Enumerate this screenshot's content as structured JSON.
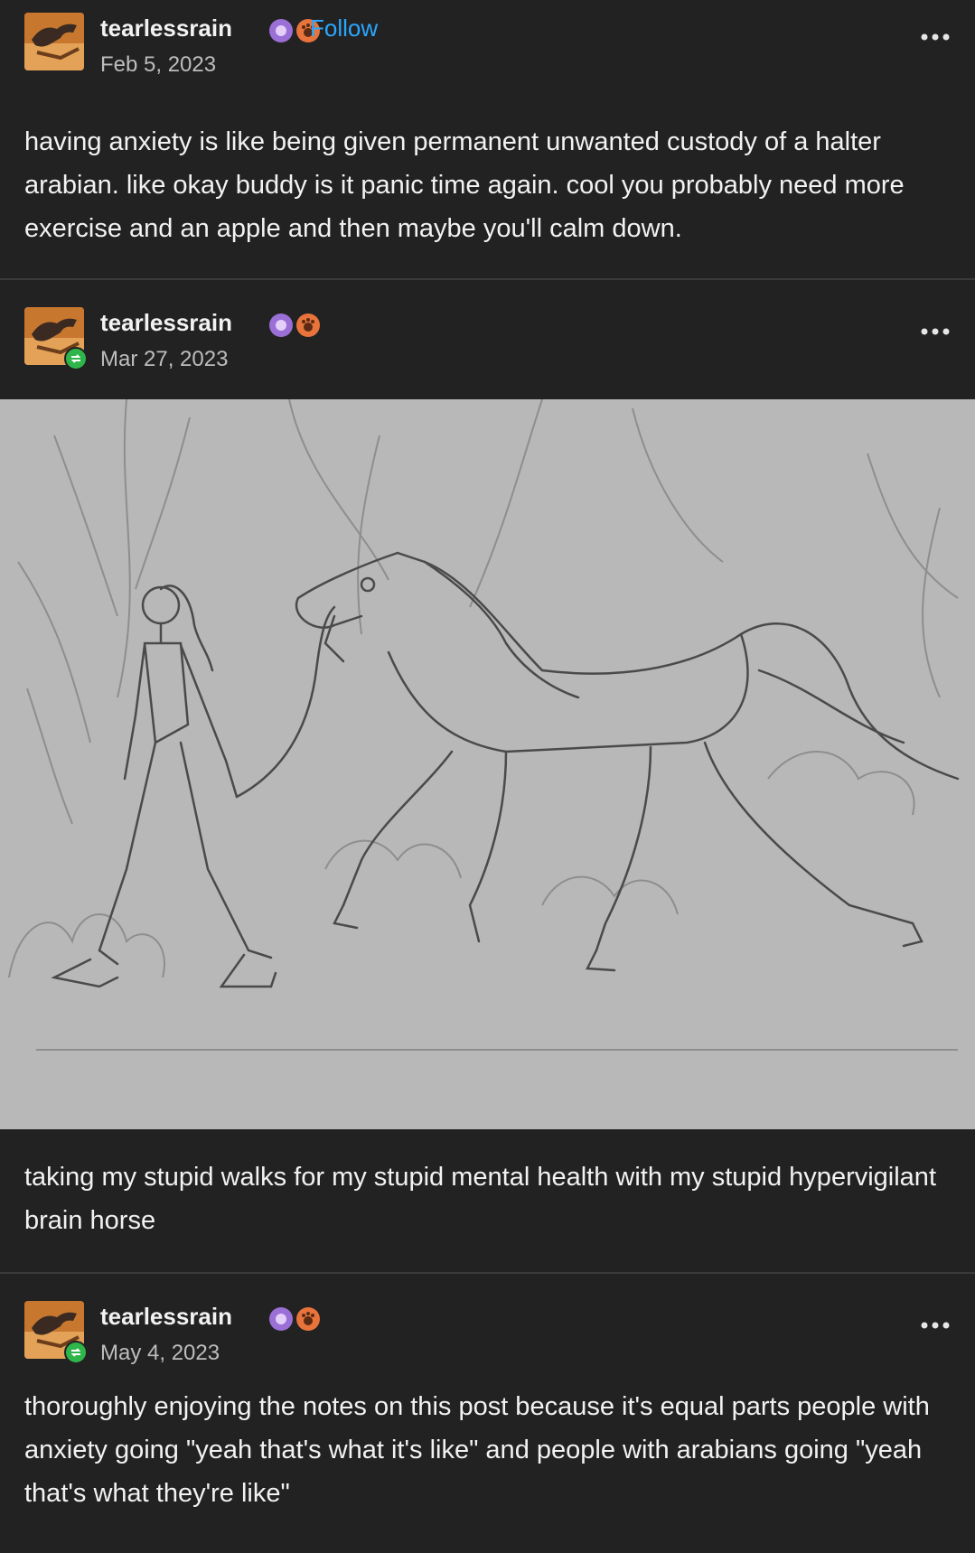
{
  "posts": [
    {
      "username": "tearlessrain",
      "follow_label": "Follow",
      "date": "Feb 5, 2023",
      "body": "having anxiety is like being given permanent unwanted custody of a halter arabian. like okay buddy is it panic time again. cool you probably need more exercise and an apple and then maybe you'll calm down."
    },
    {
      "username": "tearlessrain",
      "date": "Mar 27, 2023",
      "reblog": true,
      "body": "taking my stupid walks for my stupid mental health with my stupid hypervigilant brain horse"
    },
    {
      "username": "tearlessrain",
      "date": "May 4, 2023",
      "reblog": true,
      "body": "thoroughly enjoying the notes on this post because it's equal parts people with anxiety going \"yeah that's what it's like\" and people with arabians going \"yeah that's what they're like\""
    }
  ],
  "icons": {
    "avatar": "horse-avatar-icon",
    "badge_1": "purple-flower-badge-icon",
    "badge_2": "orange-paw-badge-icon",
    "more": "more-options-icon",
    "reblog": "reblog-icon"
  },
  "colors": {
    "background": "#222222",
    "text": "#f2f2f2",
    "muted": "#bdbdbd",
    "follow": "#2aa7ff",
    "reblog": "#2fb64a",
    "artwork_bg": "#b8b8b8"
  }
}
